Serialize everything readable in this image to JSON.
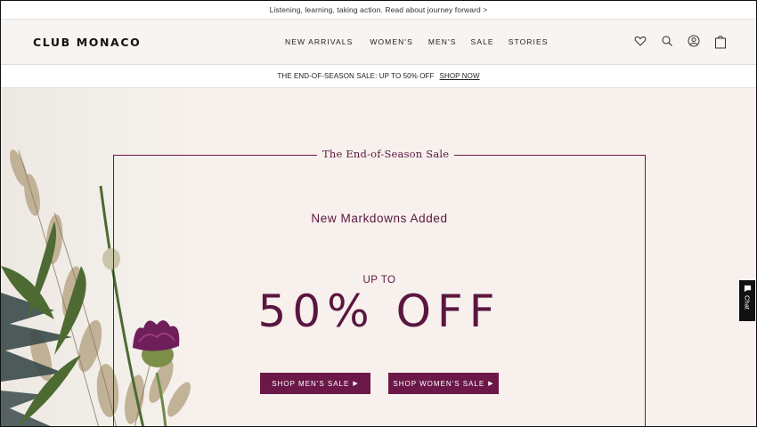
{
  "announcement": {
    "text": "Listening, learning, taking action. Read about journey forward >"
  },
  "header": {
    "logo": "CLUB MONACO",
    "nav": [
      "NEW ARRIVALS",
      "WOMEN'S",
      "MEN'S",
      "SALE",
      "STORIES"
    ],
    "icons": [
      "heart-icon",
      "search-icon",
      "account-icon",
      "bag-icon"
    ]
  },
  "promo": {
    "text": "THE END-OF-SEASON SALE: UP TO 50% OFF",
    "link": "SHOP NOW"
  },
  "hero": {
    "frame_title": "The End-of-Season Sale",
    "subtitle": "New Markdowns Added",
    "up_to": "UP TO",
    "discount": "50% OFF",
    "buttons": {
      "men": "SHOP MEN'S SALE",
      "women": "SHOP WOMEN'S SALE"
    }
  },
  "chat": {
    "label": "Chat"
  },
  "colors": {
    "accent": "#6b1848",
    "hero_bg": "#f7f0ec",
    "header_bg": "#f7f4f1"
  }
}
